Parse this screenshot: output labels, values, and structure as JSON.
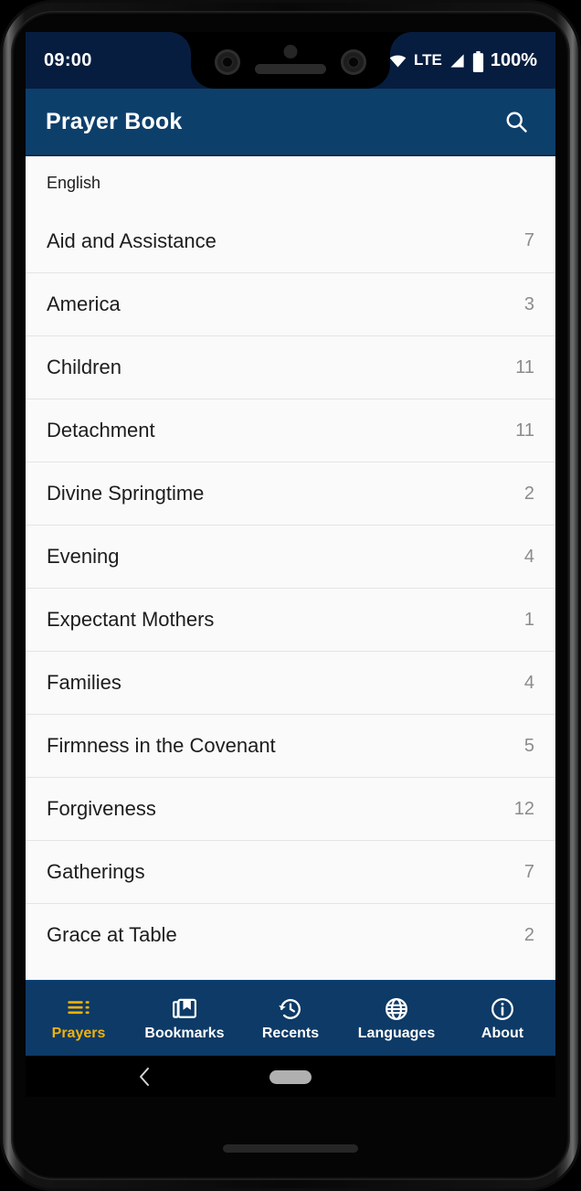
{
  "status_bar": {
    "time": "09:00",
    "network_type": "LTE",
    "battery_percent": "100%",
    "icons": [
      "wifi-icon",
      "signal-icon",
      "battery-icon"
    ]
  },
  "app_bar": {
    "title": "Prayer Book",
    "search_icon": "search-icon"
  },
  "list": {
    "language_header": "English",
    "rows": [
      {
        "label": "Aid and Assistance",
        "count": "7"
      },
      {
        "label": "America",
        "count": "3"
      },
      {
        "label": "Children",
        "count": "11"
      },
      {
        "label": "Detachment",
        "count": "11"
      },
      {
        "label": "Divine Springtime",
        "count": "2"
      },
      {
        "label": "Evening",
        "count": "4"
      },
      {
        "label": "Expectant Mothers",
        "count": "1"
      },
      {
        "label": "Families",
        "count": "4"
      },
      {
        "label": "Firmness in the Covenant",
        "count": "5"
      },
      {
        "label": "Forgiveness",
        "count": "12"
      },
      {
        "label": "Gatherings",
        "count": "7"
      },
      {
        "label": "Grace at Table",
        "count": "2"
      }
    ]
  },
  "bottom_nav": {
    "active_color": "#f2b209",
    "inactive_color": "#ffffff",
    "background": "#0d3a66",
    "items": [
      {
        "label": "Prayers",
        "icon": "list-icon",
        "active": true
      },
      {
        "label": "Bookmarks",
        "icon": "library-books-icon",
        "active": false
      },
      {
        "label": "Recents",
        "icon": "history-icon",
        "active": false
      },
      {
        "label": "Languages",
        "icon": "globe-icon",
        "active": false
      },
      {
        "label": "About",
        "icon": "info-circle-icon",
        "active": false
      }
    ]
  },
  "gesture_nav": {
    "back_icon": "back-chevron-icon",
    "home_pill": "home-pill-handle"
  },
  "theme": {
    "status_bar_bg": "#071d3f",
    "app_bar_bg": "#0d3f6b",
    "list_bg": "#fafafa",
    "divider": "#e4e4e4",
    "count_text": "#8b8b8b"
  }
}
